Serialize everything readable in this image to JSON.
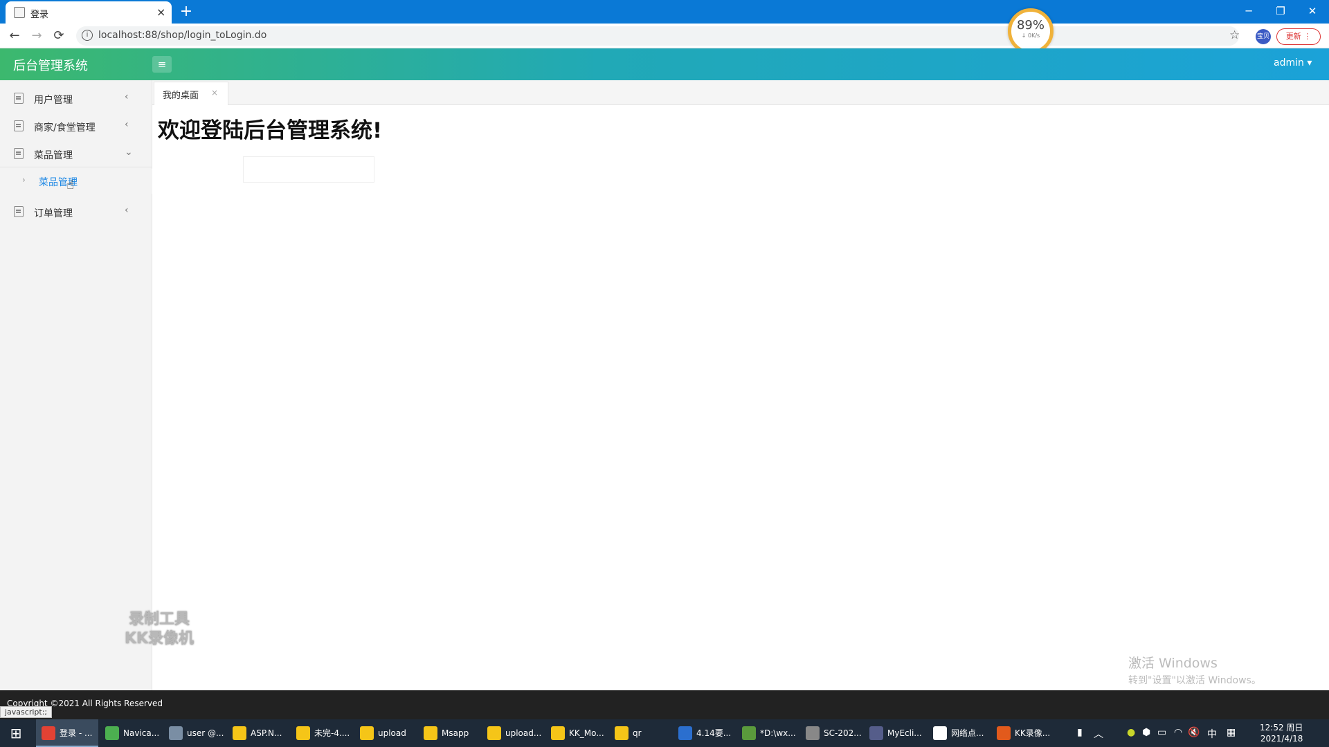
{
  "browser": {
    "tab_title": "登录",
    "tab_close": "×",
    "new_tab": "+",
    "win_controls": [
      "─",
      "❐",
      "✕"
    ],
    "nav": {
      "back": "←",
      "forward": "→",
      "reload": "⟳"
    },
    "info_glyph": "i",
    "url": "localhost:88/shop/login_toLogin.do",
    "star": "☆",
    "ext_label": "宝贝",
    "update_label": "更新  ⋮",
    "speed": {
      "percent": "89%",
      "rate": "↓ 0K/s"
    }
  },
  "header": {
    "brand": "后台管理系统",
    "menu_toggle": "≡",
    "user": "admin ▾"
  },
  "sidebar": {
    "items": [
      {
        "label": "用户管理",
        "chevron": "‹"
      },
      {
        "label": "商家/食堂管理",
        "chevron": "‹"
      },
      {
        "label": "菜品管理",
        "chevron": "⌄"
      },
      {
        "label": "订单管理",
        "chevron": "‹"
      }
    ],
    "sub_items": [
      {
        "label": "菜品管理",
        "arrow": "›"
      }
    ]
  },
  "tabs": {
    "desk_label": "我的桌面",
    "desk_close": "×"
  },
  "main": {
    "welcome": "欢迎登陆后台管理系统!"
  },
  "watermark": {
    "line1": "录制工具",
    "line2": "KK录像机"
  },
  "activation": {
    "title": "激活 Windows",
    "sub": "转到\"设置\"以激活 Windows。"
  },
  "footer": {
    "copyright": "Copyright ©2021 All Rights Reserved"
  },
  "status_bar": "javascript:;",
  "taskbar": {
    "start": "⊞",
    "tasks": [
      {
        "label": "登录 - ...",
        "color": "#e34234",
        "active": true
      },
      {
        "label": "Navica...",
        "color": "#4caf50"
      },
      {
        "label": "user @...",
        "color": "#7a8ea4"
      },
      {
        "label": "ASP.N...",
        "color": "#f5c518"
      },
      {
        "label": "未完-4....",
        "color": "#f5c518"
      },
      {
        "label": "upload",
        "color": "#f5c518"
      },
      {
        "label": "Msapp",
        "color": "#f5c518"
      },
      {
        "label": "upload...",
        "color": "#f5c518"
      },
      {
        "label": "KK_Mo...",
        "color": "#f5c518"
      },
      {
        "label": "qr",
        "color": "#f5c518"
      },
      {
        "label": "4.14要...",
        "color": "#2b6fcf"
      },
      {
        "label": "*D:\\wx...",
        "color": "#5a9a3c"
      },
      {
        "label": "SC-202...",
        "color": "#888888"
      },
      {
        "label": "MyEcli...",
        "color": "#555d8a"
      },
      {
        "label": "网络点...",
        "color": "#ffffff"
      },
      {
        "label": "KK录像...",
        "color": "#e25a1c"
      }
    ],
    "tray": [
      "▮",
      "︿",
      "●",
      "⬢",
      "▭",
      "◠",
      "🔇",
      "中",
      "▦"
    ],
    "time": "12:52 周日",
    "date": "2021/4/18"
  }
}
